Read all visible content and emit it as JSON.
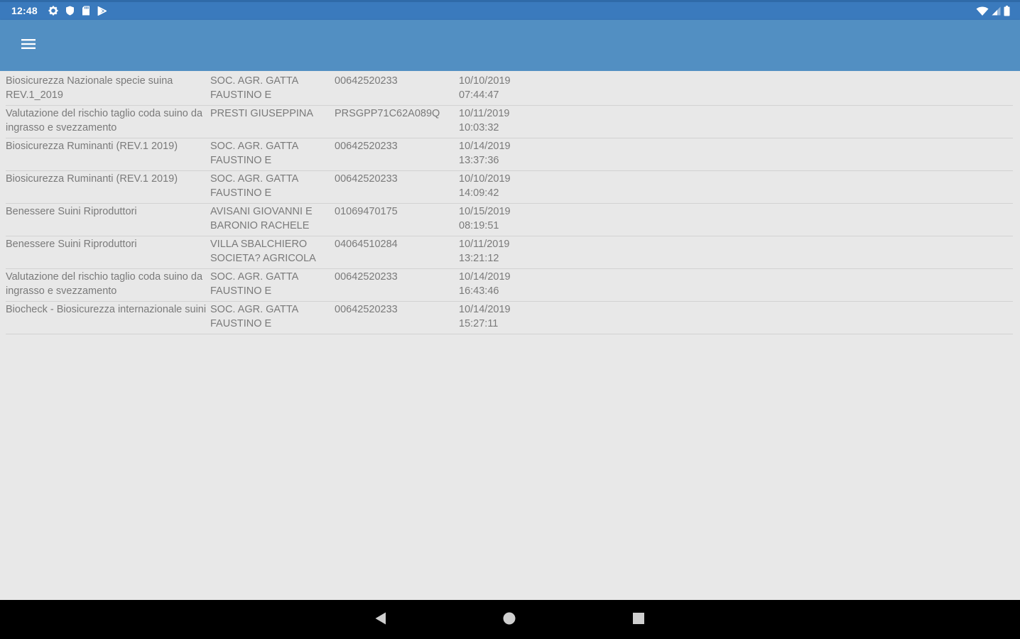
{
  "status_bar": {
    "time": "12:48",
    "left_icons": [
      "settings-icon",
      "shield-icon",
      "sd-card-icon",
      "play-store-icon"
    ],
    "right_icons": [
      "wifi-icon",
      "cell-signal-icon",
      "battery-icon"
    ]
  },
  "app_bar": {
    "menu_icon": "hamburger-menu-icon",
    "color": "#528fc2"
  },
  "records": [
    {
      "survey": "Biosicurezza Nazionale specie suina REV.1_2019",
      "farm": "SOC. AGR. GATTA FAUSTINO E",
      "code": "00642520233",
      "date": "10/10/2019",
      "time": "07:44:47"
    },
    {
      "survey": "Valutazione del rischio taglio coda suino da ingrasso e svezzamento",
      "farm": "PRESTI GIUSEPPINA",
      "code": "PRSGPP71C62A089Q",
      "date": "10/11/2019",
      "time": "10:03:32"
    },
    {
      "survey": "Biosicurezza Ruminanti (REV.1 2019)",
      "farm": "SOC. AGR. GATTA FAUSTINO E",
      "code": "00642520233",
      "date": "10/14/2019",
      "time": "13:37:36"
    },
    {
      "survey": "Biosicurezza Ruminanti (REV.1 2019)",
      "farm": "SOC. AGR. GATTA FAUSTINO E",
      "code": "00642520233",
      "date": "10/10/2019",
      "time": "14:09:42"
    },
    {
      "survey": "Benessere Suini Riproduttori",
      "farm": "AVISANI GIOVANNI E BARONIO RACHELE",
      "code": "01069470175",
      "date": "10/15/2019",
      "time": "08:19:51"
    },
    {
      "survey": "Benessere Suini Riproduttori",
      "farm": "VILLA SBALCHIERO SOCIETA? AGRICOLA",
      "code": "04064510284",
      "date": "10/11/2019",
      "time": "13:21:12"
    },
    {
      "survey": "Valutazione del rischio taglio coda suino da ingrasso e svezzamento",
      "farm": "SOC. AGR. GATTA FAUSTINO E",
      "code": "00642520233",
      "date": "10/14/2019",
      "time": "16:43:46"
    },
    {
      "survey": "Biocheck - Biosicurezza internazionale suini",
      "farm": "SOC. AGR. GATTA FAUSTINO E",
      "code": "00642520233",
      "date": "10/14/2019",
      "time": "15:27:11"
    }
  ],
  "nav_bar": {
    "icons": [
      "back-icon",
      "home-icon",
      "recents-icon"
    ]
  },
  "colors": {
    "status_bar": "#3a7abd",
    "app_bar": "#528fc2",
    "background": "#e8e8e8",
    "text": "#7a7a7a",
    "nav_bar": "#000000"
  }
}
